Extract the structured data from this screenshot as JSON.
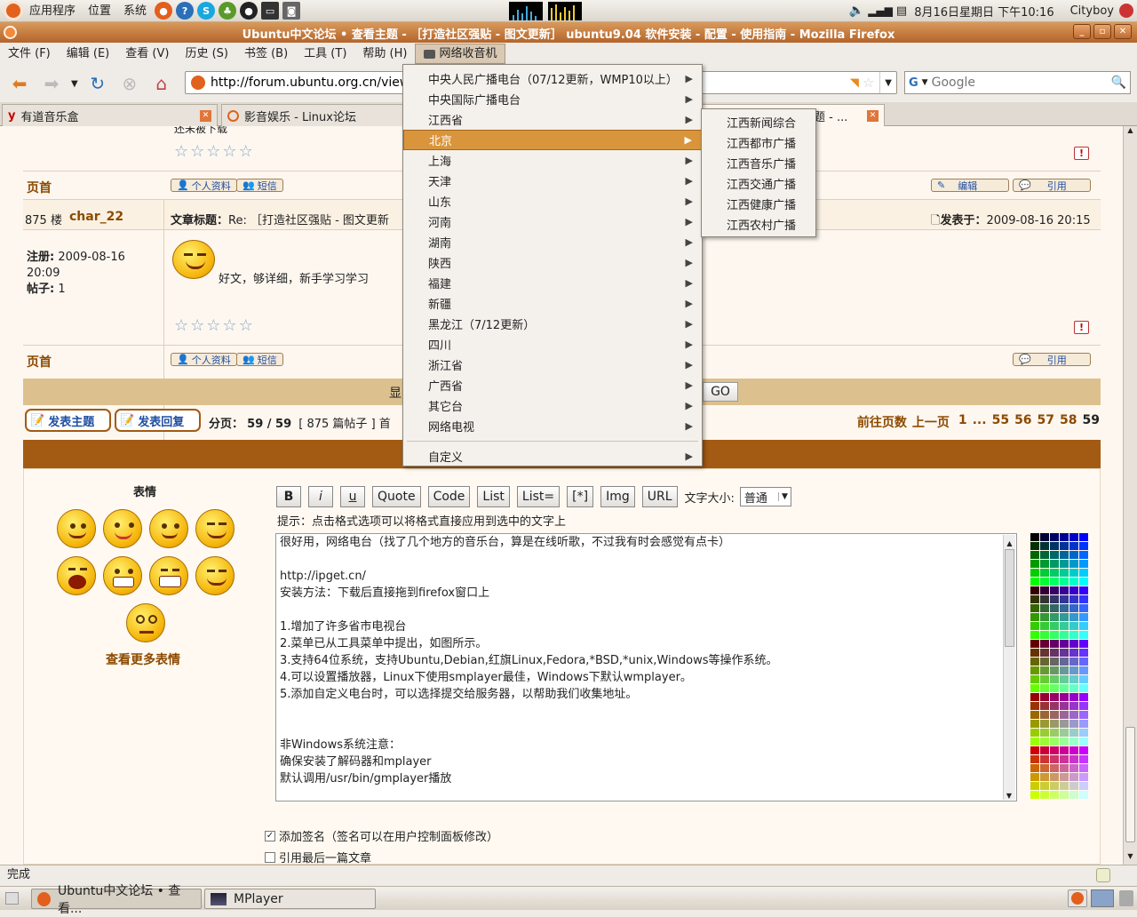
{
  "panel": {
    "menus": [
      "应用程序",
      "位置",
      "系统"
    ],
    "datetime": "8月16日星期日 下午10:16",
    "user": "Cityboy"
  },
  "window": {
    "title": "Ubuntu中文论坛 • 查看主题 - ［打造社区强贴 - 图文更新］ ubuntu9.04 软件安装 - 配置 - 使用指南 - Mozilla Firefox"
  },
  "menubar": [
    "文件 (F)",
    "编辑 (E)",
    "查看 (V)",
    "历史 (S)",
    "书签 (B)",
    "工具 (T)",
    "帮助 (H)",
    "网络收音机"
  ],
  "nav": {
    "url": "http://forum.ubuntu.org.cn/viewt",
    "search_placeholder": "Google"
  },
  "tabs": [
    {
      "label": "有道音乐盒"
    },
    {
      "label": "影音娱乐 - Linux论坛"
    },
    {
      "label": "题 - ..."
    }
  ],
  "post_top": {
    "snippet": "还未被下载",
    "page_top": "页首",
    "profile_btn": "个人资料",
    "pm_btn": "短信",
    "edit_btn": "编辑",
    "quote_btn": "引用"
  },
  "post": {
    "floor": "875 楼",
    "author": "char_22",
    "subject_label": "文章标题：",
    "subject_value": "Re: ［打造社区强贴 - 图文更新",
    "posted_label": "发表于：",
    "posted_value": "2009-08-16 20:15",
    "register_label": "注册:",
    "register_value": "2009-08-16 20:09",
    "posts_label": "帖子:",
    "posts_value": "1",
    "body": "好文，够详细，新手学习学习",
    "page_top": "页首",
    "profile_btn": "个人资料",
    "pm_btn": "短信",
    "quote_btn": "引用"
  },
  "display_bar": {
    "text": "显",
    "go": "GO"
  },
  "pagination": {
    "new_topic": "发表主题",
    "reply": "发表回复",
    "page_label": "分页：",
    "page_value": "59 / 59",
    "count": "[ 875 篇帖子 ] 首",
    "goto": "前往页数",
    "prev": "上一页",
    "pages": [
      "1",
      "...",
      "55",
      "56",
      "57",
      "58",
      "59"
    ]
  },
  "smilies": {
    "title": "表情",
    "more": "查看更多表情"
  },
  "editor": {
    "buttons": [
      "B",
      "i",
      "u",
      "Quote",
      "Code",
      "List",
      "List=",
      "[*]",
      "Img",
      "URL"
    ],
    "font_size_label": "文字大小:",
    "font_size_value": "普通",
    "hint": "提示：点击格式选项可以将格式直接应用到选中的文字上",
    "lines": [
      "很好用，网络电台（找了几个地方的音乐台，算是在线听歌，不过我有时会感觉有点卡）",
      "",
      "http://ipget.cn/",
      "安装方法：下载后直接拖到firefox窗口上",
      "",
      "1.增加了许多省市电视台",
      "2.菜单已从工具菜单中提出，如图所示。",
      "3.支持64位系统，支持Ubuntu,Debian,红旗Linux,Fedora,*BSD,*unix,Windows等操作系统。",
      "4.可以设置播放器，Linux下使用smplayer最佳，Windows下默认wmplayer。",
      "5.添加自定义电台时，可以选择提交给服务器，以帮助我们收集地址。",
      "",
      "",
      "非Windows系统注意：",
      "确保安装了解码器和mplayer",
      "默认调用/usr/bin/gmplayer播放"
    ]
  },
  "options": {
    "sig": "添加签名（签名可以在用户控制面板修改）",
    "quote_last": "引用最后一篇文章"
  },
  "radio_menu": {
    "items": [
      "中央人民广播电台（07/12更新，WMP10以上）",
      "中央国际广播电台",
      "江西省",
      "北京",
      "上海",
      "天津",
      "山东",
      "河南",
      "湖南",
      "陕西",
      "福建",
      "新疆",
      "黑龙江（7/12更新）",
      "四川",
      "浙江省",
      "广西省",
      "其它台",
      "网络电视"
    ],
    "custom": "自定义"
  },
  "submenu": {
    "items": [
      "江西新闻综合",
      "江西都市广播",
      "江西音乐广播",
      "江西交通广播",
      "江西健康广播",
      "江西农村广播"
    ]
  },
  "status": "完成",
  "taskbar": {
    "items": [
      "Ubuntu中文论坛 • 查看...",
      "MPlayer"
    ]
  },
  "colors": {
    "accent": "#d9953c",
    "titlebar": "#c27838",
    "forum_brown": "#a35a12",
    "forum_bar": "#dcc18f"
  }
}
